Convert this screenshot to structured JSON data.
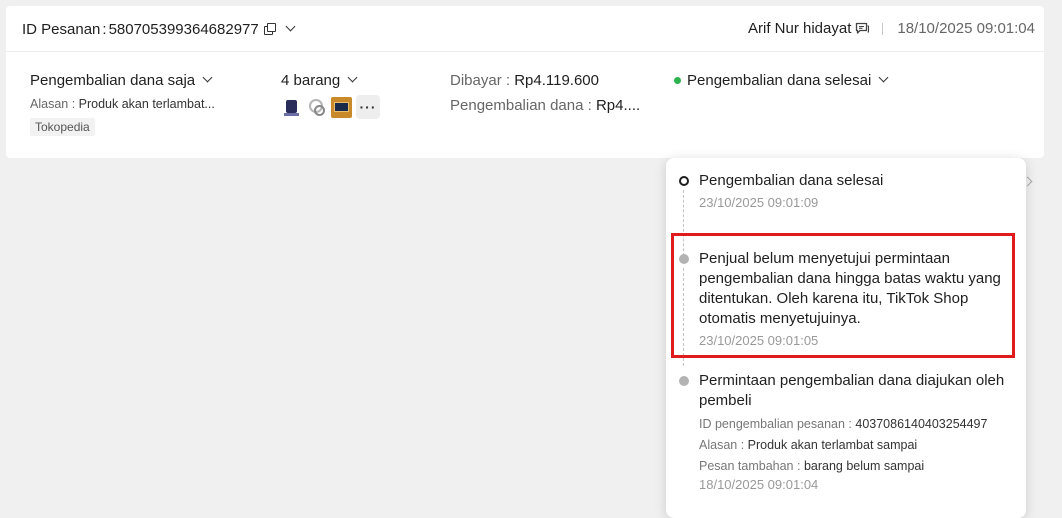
{
  "header": {
    "order_id_label": "ID Pesanan",
    "order_id_sep": ":",
    "order_id": "580705399364682977",
    "buyer_name": "Arif Nur hidayat",
    "date": "18/10/2025 09:01:04"
  },
  "refund": {
    "type_label": "Pengembalian dana saja",
    "reason_label": "Alasan",
    "reason_value": "Produk akan terlambat...",
    "source_tag": "Tokopedia"
  },
  "items": {
    "count_label": "4 barang",
    "more_label": "···"
  },
  "payment": {
    "paid_label": "Dibayar",
    "paid_value": "Rp4.119.600",
    "refund_label": "Pengembalian dana",
    "refund_value": "Rp4...."
  },
  "status": {
    "label": "Pengembalian dana selesai",
    "color": "#2bb24c"
  },
  "timeline": [
    {
      "title": "Pengembalian dana selesai",
      "time": "23/10/2025 09:01:09"
    },
    {
      "title": "Penjual belum menyetujui permintaan pengembalian dana hingga batas waktu yang ditentukan. Oleh karena itu, TikTok Shop otomatis menyetujuinya.",
      "time": "23/10/2025 09:01:05"
    },
    {
      "title": "Permintaan pengembalian dana diajukan oleh pembeli",
      "details": [
        {
          "label": "ID pengembalian pesanan",
          "value": "4037086140403254497"
        },
        {
          "label": "Alasan",
          "value": "Produk akan terlambat sampai"
        },
        {
          "label": "Pesan tambahan",
          "value": "barang belum sampai"
        }
      ],
      "time": "18/10/2025 09:01:04"
    }
  ],
  "colors": {
    "highlight": "#e01b1b",
    "status_green": "#2bb24c"
  }
}
